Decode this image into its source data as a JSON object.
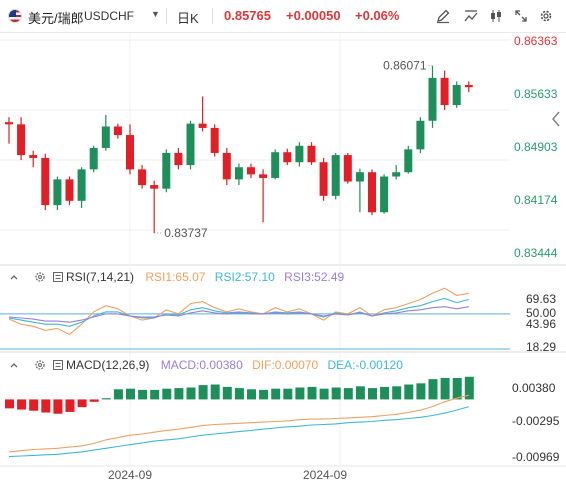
{
  "header": {
    "flag_icon": "us-flag-icon",
    "symbol_name": "美元/瑞郎",
    "symbol_code": "USDCHF",
    "timeframe": "日K",
    "last_price": "0.85765",
    "change": "+0.00050",
    "change_pct": "+0.06%",
    "toolbar_icons": [
      "pencil-icon",
      "indicator-icon",
      "candle-type-icon",
      "fullscreen-icon",
      "settings-icon"
    ]
  },
  "colors": {
    "up": "#1e8e5a",
    "down": "#e01f26",
    "price_up_text": "#2b9a6a",
    "price_down_text": "#e0353b",
    "rsi1": "#f0a060",
    "rsi2": "#3db8d8",
    "rsi3": "#9b7fd6",
    "macd": "#1e8e5a",
    "dif": "#f0a060",
    "dea": "#3db8d8",
    "ref_line": "#5ab0e0"
  },
  "price_axis": {
    "labels": [
      "0.86363",
      "0.85633",
      "0.84903",
      "0.84174",
      "0.83444"
    ],
    "highlight_label": "0.85633"
  },
  "annotations": {
    "high": "0.86071",
    "low": "0.83737"
  },
  "rsi": {
    "title": "RSI(7,14,21)",
    "rsi1_label": "RSI1:65.07",
    "rsi2_label": "RSI2:57.10",
    "rsi3_label": "RSI3:52.49",
    "axis_labels": [
      "69.63",
      "50.00",
      "43.96",
      "18.29"
    ]
  },
  "macd": {
    "title": "MACD(12,26,9)",
    "macd_label": "MACD:0.00380",
    "dif_label": "DIF:0.00070",
    "dea_label": "DEA:-0.00120",
    "axis_labels": [
      "0.00380",
      "-0.00295",
      "-0.00969"
    ]
  },
  "time_axis": {
    "labels": [
      "2024-09",
      "2024-09"
    ]
  },
  "chart_data": {
    "type": "candlestick",
    "price_range": [
      0.8338,
      0.8643
    ],
    "candles": [
      {
        "o": 0.8528,
        "h": 0.8535,
        "l": 0.8498,
        "c": 0.8525
      },
      {
        "o": 0.8525,
        "h": 0.8535,
        "l": 0.8475,
        "c": 0.8482
      },
      {
        "o": 0.8482,
        "h": 0.8488,
        "l": 0.8465,
        "c": 0.8478
      },
      {
        "o": 0.8478,
        "h": 0.8484,
        "l": 0.8405,
        "c": 0.8412
      },
      {
        "o": 0.8412,
        "h": 0.8452,
        "l": 0.8405,
        "c": 0.8448
      },
      {
        "o": 0.8448,
        "h": 0.8452,
        "l": 0.8412,
        "c": 0.8418
      },
      {
        "o": 0.8418,
        "h": 0.8465,
        "l": 0.8408,
        "c": 0.8462
      },
      {
        "o": 0.8462,
        "h": 0.8495,
        "l": 0.8458,
        "c": 0.8492
      },
      {
        "o": 0.8492,
        "h": 0.8538,
        "l": 0.8488,
        "c": 0.8522
      },
      {
        "o": 0.8522,
        "h": 0.8526,
        "l": 0.8505,
        "c": 0.851
      },
      {
        "o": 0.851,
        "h": 0.8525,
        "l": 0.8455,
        "c": 0.8462
      },
      {
        "o": 0.8462,
        "h": 0.8468,
        "l": 0.8435,
        "c": 0.844
      },
      {
        "o": 0.844,
        "h": 0.8446,
        "l": 0.8373,
        "c": 0.8435
      },
      {
        "o": 0.8435,
        "h": 0.849,
        "l": 0.843,
        "c": 0.8485
      },
      {
        "o": 0.8485,
        "h": 0.8492,
        "l": 0.8462,
        "c": 0.8468
      },
      {
        "o": 0.8468,
        "h": 0.853,
        "l": 0.8462,
        "c": 0.8526
      },
      {
        "o": 0.8526,
        "h": 0.8564,
        "l": 0.8515,
        "c": 0.852
      },
      {
        "o": 0.852,
        "h": 0.8525,
        "l": 0.848,
        "c": 0.8485
      },
      {
        "o": 0.8485,
        "h": 0.8492,
        "l": 0.844,
        "c": 0.8448
      },
      {
        "o": 0.8448,
        "h": 0.847,
        "l": 0.844,
        "c": 0.8465
      },
      {
        "o": 0.8465,
        "h": 0.847,
        "l": 0.845,
        "c": 0.8455
      },
      {
        "o": 0.8455,
        "h": 0.8462,
        "l": 0.8388,
        "c": 0.845
      },
      {
        "o": 0.845,
        "h": 0.849,
        "l": 0.8448,
        "c": 0.8486
      },
      {
        "o": 0.8486,
        "h": 0.8491,
        "l": 0.8468,
        "c": 0.8472
      },
      {
        "o": 0.8472,
        "h": 0.85,
        "l": 0.8466,
        "c": 0.8495
      },
      {
        "o": 0.8495,
        "h": 0.85,
        "l": 0.8468,
        "c": 0.8472
      },
      {
        "o": 0.8472,
        "h": 0.8478,
        "l": 0.8418,
        "c": 0.8425
      },
      {
        "o": 0.8425,
        "h": 0.8485,
        "l": 0.842,
        "c": 0.8482
      },
      {
        "o": 0.8482,
        "h": 0.8485,
        "l": 0.8442,
        "c": 0.8445
      },
      {
        "o": 0.8445,
        "h": 0.8463,
        "l": 0.8402,
        "c": 0.8458
      },
      {
        "o": 0.8458,
        "h": 0.8462,
        "l": 0.8398,
        "c": 0.8402
      },
      {
        "o": 0.8402,
        "h": 0.8455,
        "l": 0.84,
        "c": 0.8452
      },
      {
        "o": 0.8452,
        "h": 0.8468,
        "l": 0.8448,
        "c": 0.8458
      },
      {
        "o": 0.8458,
        "h": 0.8495,
        "l": 0.8456,
        "c": 0.849
      },
      {
        "o": 0.849,
        "h": 0.8535,
        "l": 0.8485,
        "c": 0.853
      },
      {
        "o": 0.853,
        "h": 0.8607,
        "l": 0.852,
        "c": 0.859
      },
      {
        "o": 0.859,
        "h": 0.86,
        "l": 0.8545,
        "c": 0.8552
      },
      {
        "o": 0.8552,
        "h": 0.8585,
        "l": 0.8548,
        "c": 0.858
      },
      {
        "o": 0.858,
        "h": 0.8585,
        "l": 0.857,
        "c": 0.8577
      }
    ],
    "rsi_range": [
      15,
      80
    ],
    "rsi1": [
      45,
      40,
      38,
      34,
      36,
      30,
      40,
      52,
      58,
      55,
      48,
      44,
      46,
      54,
      50,
      60,
      62,
      56,
      52,
      55,
      52,
      50,
      56,
      52,
      55,
      50,
      44,
      52,
      50,
      56,
      48,
      54,
      56,
      60,
      64,
      70,
      75,
      68,
      70
    ],
    "rsi2": [
      46,
      44,
      42,
      40,
      40,
      38,
      42,
      48,
      52,
      52,
      48,
      46,
      46,
      50,
      49,
      54,
      56,
      53,
      51,
      52,
      51,
      50,
      52,
      51,
      52,
      50,
      47,
      51,
      49,
      52,
      48,
      51,
      53,
      56,
      58,
      62,
      65,
      61,
      64
    ],
    "rsi3": [
      47,
      46,
      45,
      43,
      43,
      42,
      44,
      47,
      50,
      50,
      48,
      47,
      47,
      49,
      48,
      51,
      53,
      51,
      50,
      51,
      50,
      50,
      51,
      50,
      51,
      50,
      48,
      50,
      49,
      51,
      48,
      50,
      51,
      53,
      54,
      56,
      57,
      55,
      57
    ],
    "macd_range": [
      -0.0105,
      0.0046
    ],
    "macd_hist": [
      -0.0015,
      -0.0017,
      -0.0019,
      -0.0022,
      -0.0024,
      -0.0021,
      -0.0013,
      -0.0004,
      0.0002,
      0.0017,
      0.0018,
      0.0016,
      0.0016,
      0.0018,
      0.0019,
      0.002,
      0.0024,
      0.0025,
      0.0021,
      0.0019,
      0.0017,
      0.0016,
      0.0018,
      0.0018,
      0.002,
      0.0021,
      0.0018,
      0.002,
      0.0019,
      0.0022,
      0.0019,
      0.0021,
      0.0022,
      0.0025,
      0.0027,
      0.0034,
      0.0036,
      0.0036,
      0.0038
    ],
    "dif": [
      -0.0088,
      -0.0086,
      -0.0084,
      -0.0083,
      -0.0082,
      -0.008,
      -0.0078,
      -0.0074,
      -0.0068,
      -0.0064,
      -0.006,
      -0.0058,
      -0.0055,
      -0.0052,
      -0.005,
      -0.0047,
      -0.0044,
      -0.0042,
      -0.0041,
      -0.004,
      -0.0039,
      -0.0038,
      -0.0037,
      -0.0036,
      -0.0034,
      -0.0033,
      -0.0033,
      -0.0032,
      -0.0031,
      -0.003,
      -0.0029,
      -0.0027,
      -0.0025,
      -0.0022,
      -0.0018,
      -0.0012,
      -0.0004,
      0.0002,
      0.0007
    ],
    "dea": [
      -0.0096,
      -0.0095,
      -0.0094,
      -0.0093,
      -0.0092,
      -0.009,
      -0.0088,
      -0.0085,
      -0.0082,
      -0.0079,
      -0.0076,
      -0.0073,
      -0.007,
      -0.0068,
      -0.0066,
      -0.0063,
      -0.006,
      -0.0058,
      -0.0056,
      -0.0054,
      -0.0052,
      -0.005,
      -0.0048,
      -0.0046,
      -0.0045,
      -0.0043,
      -0.0042,
      -0.0041,
      -0.0039,
      -0.0038,
      -0.0037,
      -0.0035,
      -0.0034,
      -0.0032,
      -0.003,
      -0.0027,
      -0.0023,
      -0.0018,
      -0.0012
    ]
  }
}
